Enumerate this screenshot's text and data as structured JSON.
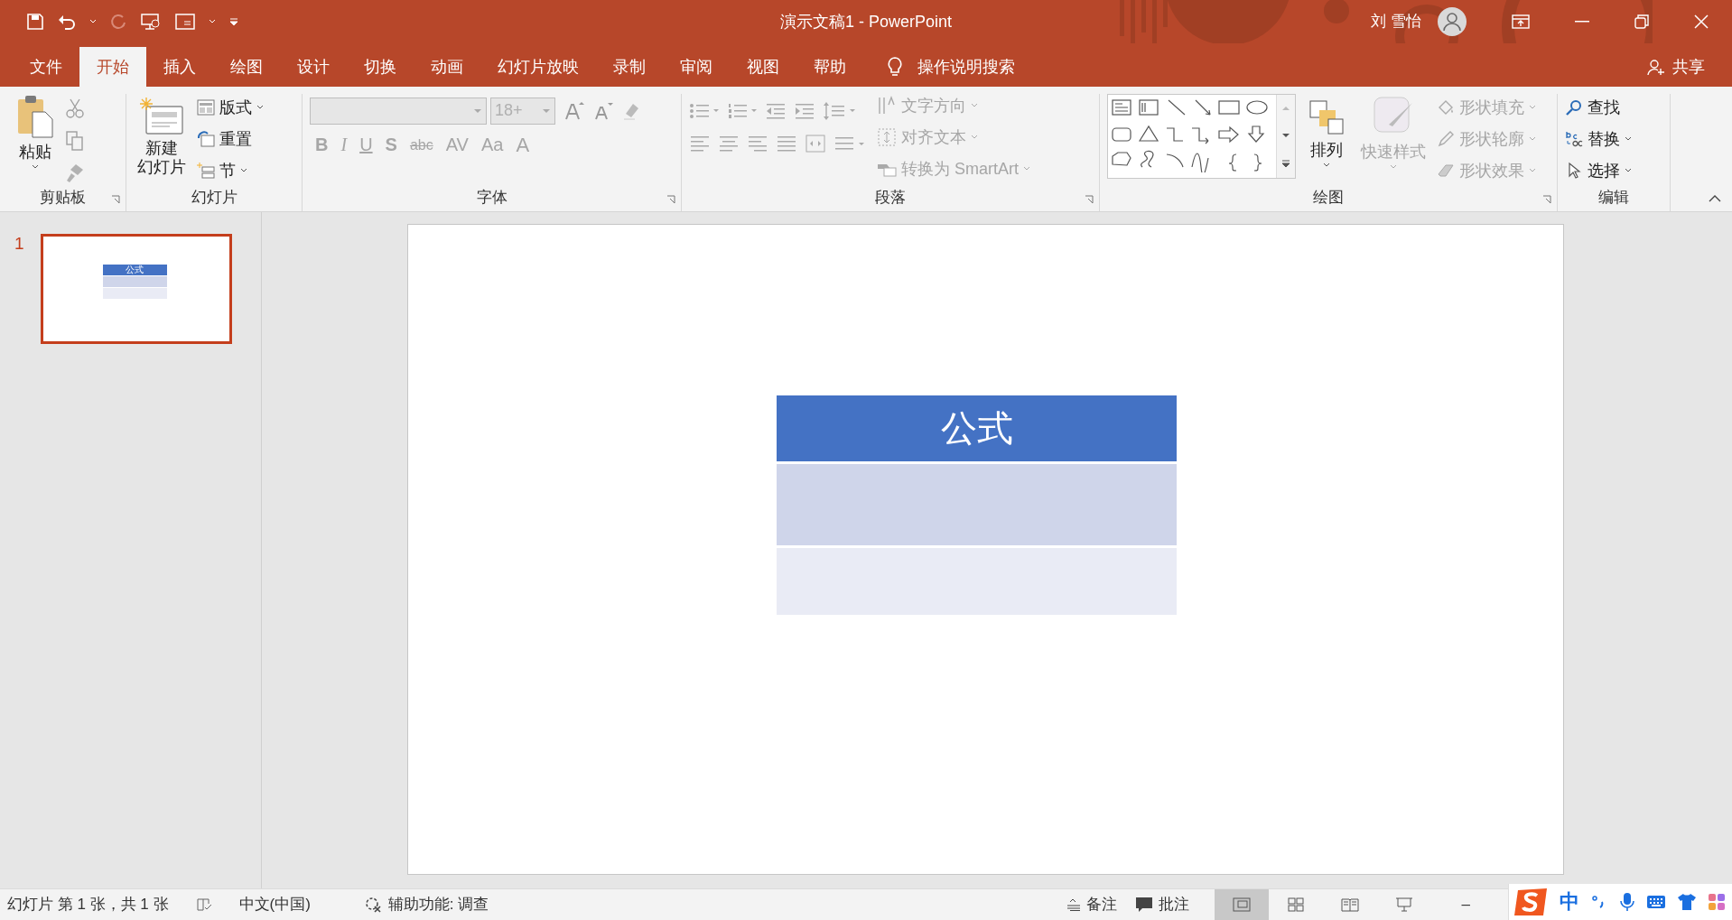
{
  "title_bar": {
    "title": "演示文稿1  -  PowerPoint",
    "user": "刘 雪怡"
  },
  "tabs": [
    {
      "label": "文件",
      "selected": false
    },
    {
      "label": "开始",
      "selected": true
    },
    {
      "label": "插入",
      "selected": false
    },
    {
      "label": "绘图",
      "selected": false
    },
    {
      "label": "设计",
      "selected": false
    },
    {
      "label": "切换",
      "selected": false
    },
    {
      "label": "动画",
      "selected": false
    },
    {
      "label": "幻灯片放映",
      "selected": false
    },
    {
      "label": "录制",
      "selected": false
    },
    {
      "label": "审阅",
      "selected": false
    },
    {
      "label": "视图",
      "selected": false
    },
    {
      "label": "帮助",
      "selected": false
    }
  ],
  "tell_me": "操作说明搜索",
  "share": "共享",
  "clipboard": {
    "paste": "粘贴",
    "label": "剪贴板",
    "tools": [
      {
        "kind": "cut",
        "disabled": true
      },
      {
        "kind": "copy",
        "disabled": true
      },
      {
        "kind": "format-painter",
        "disabled": true
      }
    ]
  },
  "slides_group": {
    "new_slide_lines": [
      "新建",
      "幻灯片"
    ],
    "items": [
      {
        "label": "版式",
        "dropdown": true
      },
      {
        "label": "重置",
        "dropdown": false
      },
      {
        "label": "节",
        "dropdown": true
      }
    ],
    "label": "幻灯片"
  },
  "font": {
    "font_size": "18+",
    "buttons": [
      "B",
      "I",
      "U",
      "S",
      "abc",
      "AV",
      "Aa",
      "A"
    ],
    "disabled": true,
    "label": "字体"
  },
  "paragraph": {
    "commands": [
      {
        "label": "文字方向",
        "disabled": true
      },
      {
        "label": "对齐文本",
        "disabled": true
      },
      {
        "label": "转换为 SmartArt",
        "disabled": true
      }
    ],
    "label": "段落"
  },
  "drawing": {
    "arrange": "排列",
    "quick_styles": {
      "label": "快速样式",
      "disabled": true
    },
    "commands": [
      {
        "label": "形状填充",
        "disabled": true
      },
      {
        "label": "形状轮廓",
        "disabled": true
      },
      {
        "label": "形状效果",
        "disabled": true
      }
    ],
    "label": "绘图"
  },
  "editing": {
    "commands": [
      {
        "label": "查找",
        "kind": "find"
      },
      {
        "label": "替换",
        "kind": "replace"
      },
      {
        "label": "选择",
        "kind": "select"
      }
    ],
    "label": "编辑"
  },
  "thumbnails": [
    {
      "number": "1",
      "selected": true,
      "table_title": "公式"
    }
  ],
  "slide": {
    "table": {
      "header": "公式",
      "rows": [
        {
          "kind": "band"
        },
        {
          "kind": "plain"
        }
      ]
    }
  },
  "status_bar": {
    "slide_info": "幻灯片 第 1 张，共 1 张",
    "language": "中文(中国)",
    "accessibility": "辅助功能: 调查",
    "notes": "备注",
    "comments": "批注",
    "views": [
      {
        "kind": "normal",
        "selected": true
      },
      {
        "kind": "sorter",
        "selected": false
      },
      {
        "kind": "reading",
        "selected": false
      },
      {
        "kind": "slideshow",
        "selected": false
      }
    ],
    "zoom_out": "–"
  },
  "ime_toolbar": {
    "mode": "中"
  }
}
